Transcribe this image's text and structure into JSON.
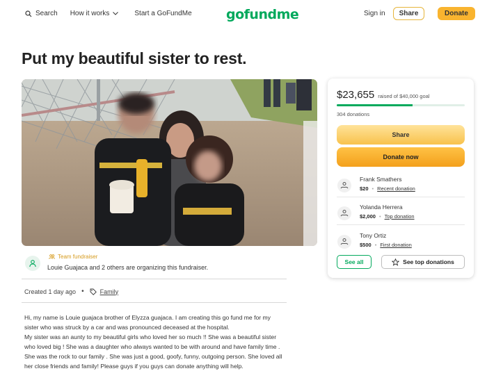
{
  "header": {
    "search_label": "Search",
    "how_it_works_label": "How it works",
    "start_label": "Start a GoFundMe",
    "logo_text": "gofundme",
    "signin_label": "Sign in",
    "share_label": "Share",
    "donate_label": "Donate"
  },
  "campaign": {
    "title": "Put my beautiful sister to rest.",
    "team_label": "Team fundraiser",
    "organizers_text": "Louie Guajaca and 2 others are organizing this fundraiser.",
    "created_text": "Created 1 day ago",
    "category": "Family",
    "story": "Hi, my name is Louie guajaca brother of Elyzza guajaca. I am creating this go fund me for my sister who was struck by a car and was pronounced deceased at the hospital.\nMy sister was an aunty to my beautiful girls who loved her so much !! She was a beautiful sister who loved big ! She was a daughter who always wanted to be with around and have family time . She was the rock to our family . She was just a good, goofy, funny, outgoing person. She loved all her close friends and family! Please guys if you guys can donate anything will help."
  },
  "donation_card": {
    "raised": "$23,655",
    "goal_text": "raised of $40,000 goal",
    "progress_fraction": 0.591,
    "donations_count": "304 donations",
    "share_label": "Share",
    "donate_now_label": "Donate now",
    "donors": [
      {
        "name": "Frank Smathers",
        "amount": "$20",
        "kind": "Recent donation"
      },
      {
        "name": "Yolanda Herrera",
        "amount": "$2,000",
        "kind": "Top donation"
      },
      {
        "name": "Tony Ortiz",
        "amount": "$500",
        "kind": "First donation"
      }
    ],
    "see_all_label": "See all",
    "see_top_label": "See top donations"
  },
  "colors": {
    "brand_green": "#02a95c",
    "donate_yellow": "#f9b42f"
  }
}
